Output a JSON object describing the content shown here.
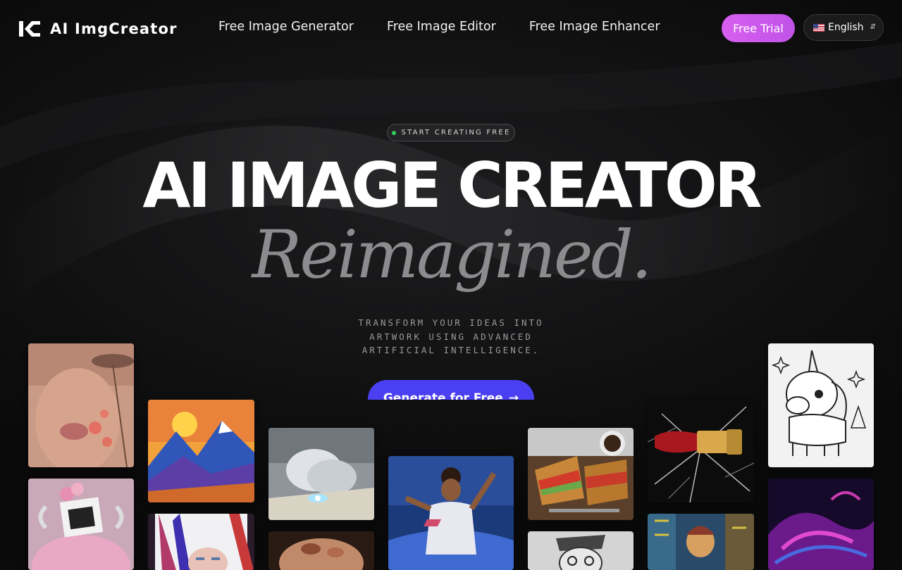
{
  "brand": {
    "name": "AI ImgCreator"
  },
  "nav": {
    "items": [
      {
        "label": "Free Image Generator"
      },
      {
        "label": "Free Image Editor"
      },
      {
        "label": "Free Image Enhancer"
      }
    ]
  },
  "header": {
    "trial_label": "Free Trial",
    "language_label": "English"
  },
  "hero": {
    "badge": "START CREATING FREE",
    "title": "AI IMAGE CREATOR",
    "subtitle": "Reimagined.",
    "description_lines": [
      "TRANSFORM YOUR IDEAS INTO",
      "ARTWORK USING ADVANCED",
      "ARTIFICIAL INTELLIGENCE."
    ],
    "cta_label": "Generate for Free"
  },
  "colors": {
    "background": "#0b0b0c",
    "trial_gradient_start": "#d75ff0",
    "trial_gradient_end": "#c053e8",
    "cta": "#4b3ff2",
    "badge_dot": "#2fcf5e"
  },
  "icons": {
    "logo": "brand-logo-icon",
    "language": "us-flag-icon",
    "language_toggle": "chevron-updown-icon",
    "cta_arrow": "arrow-right-icon"
  }
}
